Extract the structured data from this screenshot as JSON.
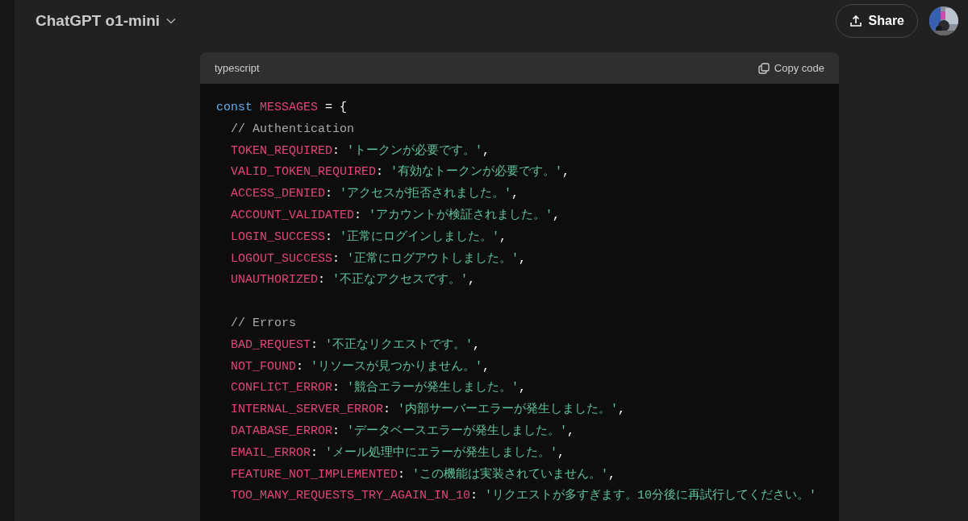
{
  "header": {
    "model_title": "ChatGPT o1-mini",
    "share_button": "Share"
  },
  "code_block": {
    "language": "typescript",
    "copy_button": "Copy code",
    "lines": [
      {
        "kind": "code",
        "indented": false,
        "tokens": [
          {
            "kind": "keyword",
            "text": "const"
          },
          {
            "kind": "name",
            "text": "MESSAGES"
          },
          {
            "kind": "plain",
            "text": " = {"
          }
        ]
      },
      {
        "kind": "code",
        "indented": true,
        "tokens": [
          {
            "kind": "comment",
            "text": "// Authentication"
          }
        ]
      },
      {
        "kind": "code",
        "indented": true,
        "tokens": [
          {
            "kind": "name",
            "text": "TOKEN_REQUIRED"
          },
          {
            "kind": "plain",
            "text": ": "
          },
          {
            "kind": "string",
            "text": "'トークンが必要です。'"
          },
          {
            "kind": "plain",
            "text": ","
          }
        ]
      },
      {
        "kind": "code",
        "indented": true,
        "tokens": [
          {
            "kind": "name",
            "text": "VALID_TOKEN_REQUIRED"
          },
          {
            "kind": "plain",
            "text": ": "
          },
          {
            "kind": "string",
            "text": "'有効なトークンが必要です。'"
          },
          {
            "kind": "plain",
            "text": ","
          }
        ]
      },
      {
        "kind": "code",
        "indented": true,
        "tokens": [
          {
            "kind": "name",
            "text": "ACCESS_DENIED"
          },
          {
            "kind": "plain",
            "text": ": "
          },
          {
            "kind": "string",
            "text": "'アクセスが拒否されました。'"
          },
          {
            "kind": "plain",
            "text": ","
          }
        ]
      },
      {
        "kind": "code",
        "indented": true,
        "tokens": [
          {
            "kind": "name",
            "text": "ACCOUNT_VALIDATED"
          },
          {
            "kind": "plain",
            "text": ": "
          },
          {
            "kind": "string",
            "text": "'アカウントが検証されました。'"
          },
          {
            "kind": "plain",
            "text": ","
          }
        ]
      },
      {
        "kind": "code",
        "indented": true,
        "tokens": [
          {
            "kind": "name",
            "text": "LOGIN_SUCCESS"
          },
          {
            "kind": "plain",
            "text": ": "
          },
          {
            "kind": "string",
            "text": "'正常にログインしました。'"
          },
          {
            "kind": "plain",
            "text": ","
          }
        ]
      },
      {
        "kind": "code",
        "indented": true,
        "tokens": [
          {
            "kind": "name",
            "text": "LOGOUT_SUCCESS"
          },
          {
            "kind": "plain",
            "text": ": "
          },
          {
            "kind": "string",
            "text": "'正常にログアウトしました。'"
          },
          {
            "kind": "plain",
            "text": ","
          }
        ]
      },
      {
        "kind": "code",
        "indented": true,
        "tokens": [
          {
            "kind": "name",
            "text": "UNAUTHORIZED"
          },
          {
            "kind": "plain",
            "text": ": "
          },
          {
            "kind": "string",
            "text": "'不正なアクセスです。'"
          },
          {
            "kind": "plain",
            "text": ","
          }
        ]
      },
      {
        "kind": "blank"
      },
      {
        "kind": "code",
        "indented": true,
        "tokens": [
          {
            "kind": "comment",
            "text": "// Errors"
          }
        ]
      },
      {
        "kind": "code",
        "indented": true,
        "tokens": [
          {
            "kind": "name",
            "text": "BAD_REQUEST"
          },
          {
            "kind": "plain",
            "text": ": "
          },
          {
            "kind": "string",
            "text": "'不正なリクエストです。'"
          },
          {
            "kind": "plain",
            "text": ","
          }
        ]
      },
      {
        "kind": "code",
        "indented": true,
        "tokens": [
          {
            "kind": "name",
            "text": "NOT_FOUND"
          },
          {
            "kind": "plain",
            "text": ": "
          },
          {
            "kind": "string",
            "text": "'リソースが見つかりません。'"
          },
          {
            "kind": "plain",
            "text": ","
          }
        ]
      },
      {
        "kind": "code",
        "indented": true,
        "tokens": [
          {
            "kind": "name",
            "text": "CONFLICT_ERROR"
          },
          {
            "kind": "plain",
            "text": ": "
          },
          {
            "kind": "string",
            "text": "'競合エラーが発生しました。'"
          },
          {
            "kind": "plain",
            "text": ","
          }
        ]
      },
      {
        "kind": "code",
        "indented": true,
        "tokens": [
          {
            "kind": "name",
            "text": "INTERNAL_SERVER_ERROR"
          },
          {
            "kind": "plain",
            "text": ": "
          },
          {
            "kind": "string",
            "text": "'内部サーバーエラーが発生しました。'"
          },
          {
            "kind": "plain",
            "text": ","
          }
        ]
      },
      {
        "kind": "code",
        "indented": true,
        "tokens": [
          {
            "kind": "name",
            "text": "DATABASE_ERROR"
          },
          {
            "kind": "plain",
            "text": ": "
          },
          {
            "kind": "string",
            "text": "'データベースエラーが発生しました。'"
          },
          {
            "kind": "plain",
            "text": ","
          }
        ]
      },
      {
        "kind": "code",
        "indented": true,
        "tokens": [
          {
            "kind": "name",
            "text": "EMAIL_ERROR"
          },
          {
            "kind": "plain",
            "text": ": "
          },
          {
            "kind": "string",
            "text": "'メール処理中にエラーが発生しました。'"
          },
          {
            "kind": "plain",
            "text": ","
          }
        ]
      },
      {
        "kind": "code",
        "indented": true,
        "tokens": [
          {
            "kind": "name",
            "text": "FEATURE_NOT_IMPLEMENTED"
          },
          {
            "kind": "plain",
            "text": ": "
          },
          {
            "kind": "string",
            "text": "'この機能は実装されていません。'"
          },
          {
            "kind": "plain",
            "text": ","
          }
        ]
      },
      {
        "kind": "code",
        "indented": true,
        "tokens": [
          {
            "kind": "name",
            "text": "TOO_MANY_REQUESTS_TRY_AGAIN_IN_10"
          },
          {
            "kind": "plain",
            "text": ": "
          },
          {
            "kind": "string",
            "text": "'リクエストが多すぎます。10分後に再試行してください。'"
          }
        ]
      }
    ]
  }
}
